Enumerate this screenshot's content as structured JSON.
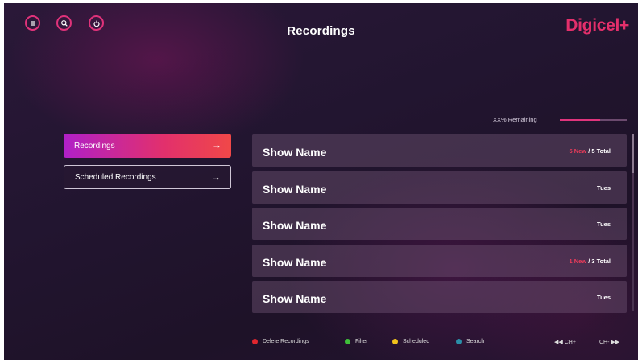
{
  "header": {
    "title": "Recordings",
    "logo": "Digicel+",
    "icons": [
      "menu-icon",
      "search-icon",
      "power-icon"
    ],
    "accent": "#e0327a"
  },
  "storage": {
    "label": "XX% Remaining",
    "fill_fraction": 0.6
  },
  "sidebar": {
    "items": [
      {
        "label": "Recordings",
        "arrow": "→",
        "active": true
      },
      {
        "label": "Scheduled Recordings",
        "arrow": "→",
        "active": false
      }
    ]
  },
  "recordings": [
    {
      "name": "Show Name",
      "new": "5 New",
      "total": " / 5 Total"
    },
    {
      "name": "Show Name",
      "day": "Tues"
    },
    {
      "name": "Show Name",
      "day": "Tues"
    },
    {
      "name": "Show Name",
      "new": "1 New",
      "total": " / 3 Total"
    },
    {
      "name": "Show Name",
      "day": "Tues"
    }
  ],
  "legend": [
    {
      "label": "Delete Recordings",
      "color": "#e0262e"
    },
    {
      "label": "Filter",
      "color": "#3fbf3a"
    },
    {
      "label": "Scheduled",
      "color": "#f1c21b"
    },
    {
      "label": "Search",
      "color": "#2a8fa8"
    }
  ],
  "channel": {
    "prev": "◀◀ CH+",
    "next": "CH- ▶▶"
  }
}
